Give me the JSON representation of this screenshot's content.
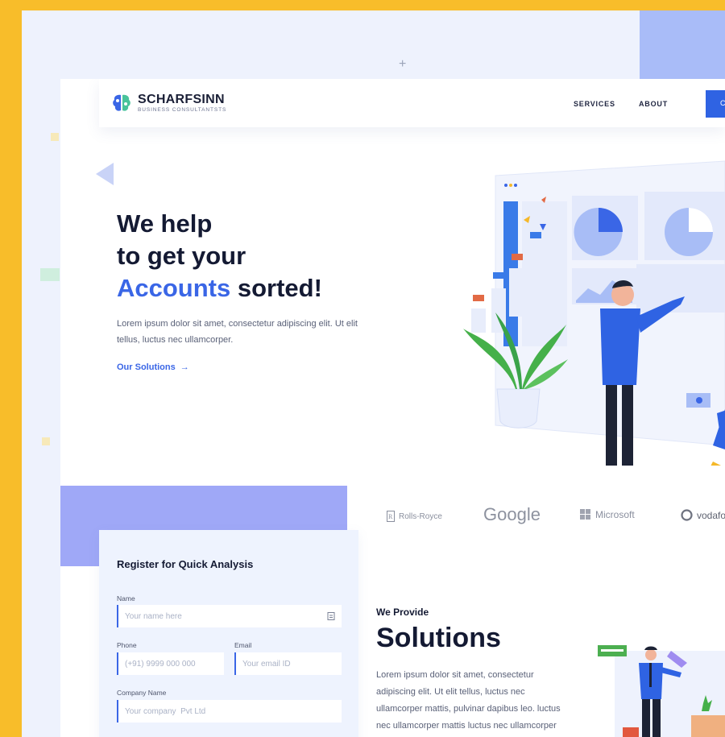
{
  "brand": {
    "name": "SCHARFSINN",
    "tagline": "BUSINESS CONSULTANTSTS"
  },
  "nav": {
    "items": [
      "SERVICES",
      "ABOUT"
    ],
    "cta_label": "C"
  },
  "hero": {
    "line1": "We help",
    "line2": "to get your",
    "accent": "Accounts",
    "line3_rest": " sorted!",
    "description": "Lorem ipsum dolor sit amet, consectetur adipiscing elit. Ut elit tellus, luctus nec ullamcorper.",
    "link_label": "Our Solutions",
    "link_arrow": "→"
  },
  "brands": [
    "Rolls-Royce",
    "Google",
    "Microsoft",
    "vodafo"
  ],
  "register": {
    "title": "Register for Quick Analysis",
    "name_label": "Name",
    "name_placeholder": "Your name here",
    "phone_label": "Phone",
    "phone_placeholder": "(+91) 9999 000 000",
    "email_label": "Email",
    "email_placeholder": "Your email ID",
    "company_label": "Company Name",
    "company_placeholder": "Your company  Pvt Ltd"
  },
  "provide": {
    "kicker": "We Provide",
    "title": "Solutions",
    "description": "Lorem ipsum dolor sit amet, consectetur adipiscing elit. Ut elit tellus, luctus nec ullamcorper mattis, pulvinar dapibus leo. luctus nec ullamcorper mattis luctus nec ullamcorper"
  },
  "colors": {
    "frame": "#f8bd2a",
    "accent": "#3a66e6",
    "heading": "#141a33",
    "purple_block": "#9fa8f7"
  },
  "icons": [
    "brain-logo-icon",
    "arrow-right-icon",
    "contact-card-icon",
    "rolls-royce-logo-icon",
    "microsoft-logo-icon",
    "vodafone-logo-icon"
  ]
}
